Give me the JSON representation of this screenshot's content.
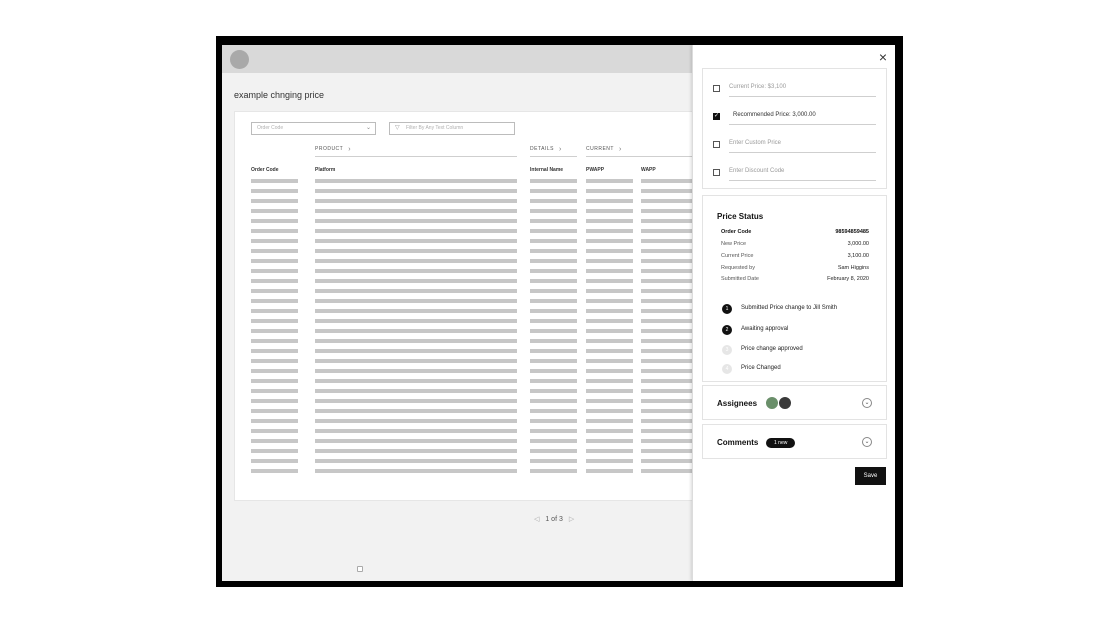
{
  "page": {
    "title": "example chnging price"
  },
  "filters": {
    "order_code_placeholder": "Order Code",
    "text_filter_placeholder": "Filter By Any Text Column"
  },
  "table": {
    "groups": [
      "PRODUCT",
      "DETAILS",
      "CURRENT"
    ],
    "columns": [
      "Order Code",
      "Platform",
      "Internal Name",
      "PWAPP",
      "WAPP"
    ],
    "placeholder_row_count": 30
  },
  "pagination": {
    "label": "1 of 3",
    "prev_icon": "triangle-left",
    "next_icon": "triangle-right"
  },
  "panel": {
    "close_label": "×",
    "price_options": [
      {
        "label": "Current Price: $3,100",
        "checked": false
      },
      {
        "label": "Recommended Price: 3,000.00",
        "checked": true
      },
      {
        "label": "Enter Custom Price",
        "checked": false
      },
      {
        "label": "Enter Discount Code",
        "checked": false
      }
    ],
    "price_status": {
      "title": "Price Status",
      "fields": [
        {
          "label": "Order Code",
          "value": "98594859485"
        },
        {
          "label": "New Price",
          "value": "3,000.00"
        },
        {
          "label": "Current Price",
          "value": "3,100.00"
        },
        {
          "label": "Requested by",
          "value": "Sam Higgins"
        },
        {
          "label": "Submitted Date",
          "value": "February 8, 2020"
        }
      ],
      "steps": [
        {
          "number": "1",
          "label": "Submitted Price change to Jill Smith",
          "active": true
        },
        {
          "number": "2",
          "label": "Awaiting approval",
          "active": true
        },
        {
          "number": "3",
          "label": "Price change approved",
          "active": false
        },
        {
          "number": "4",
          "label": "Price Changed",
          "active": false
        }
      ]
    },
    "assignees": {
      "title": "Assignees"
    },
    "comments": {
      "title": "Comments",
      "badge": "1 new"
    },
    "save_label": "Save"
  }
}
